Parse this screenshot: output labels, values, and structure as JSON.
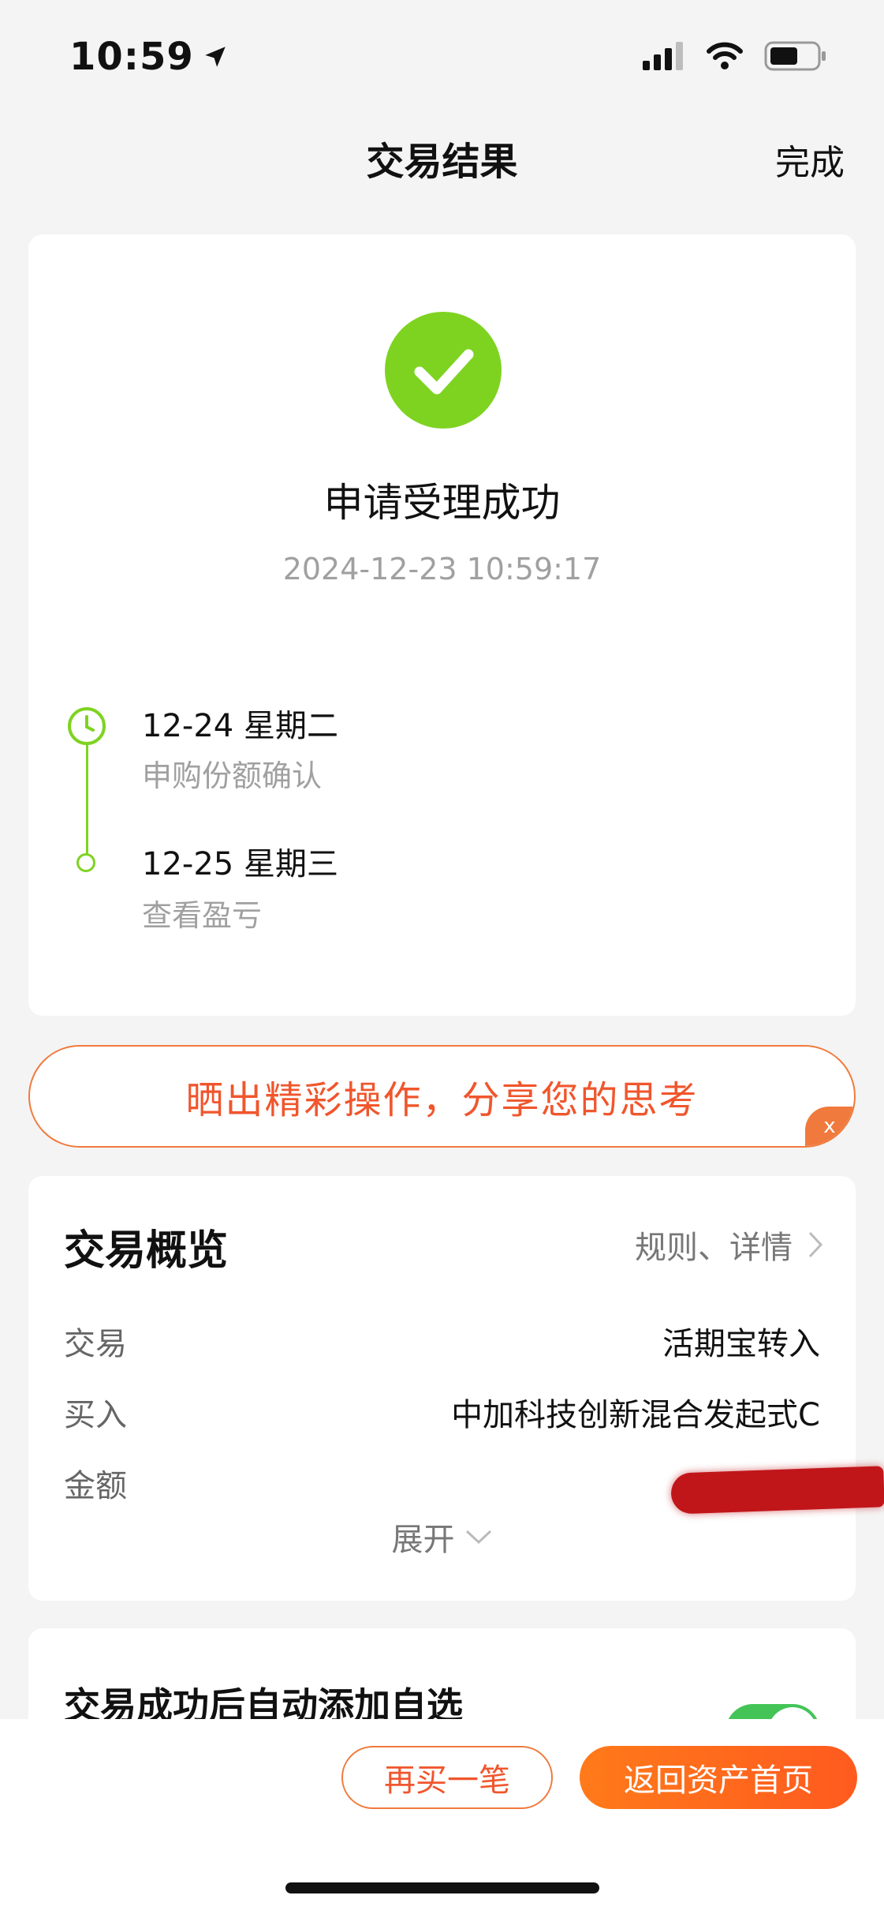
{
  "status_bar": {
    "time": "10:59"
  },
  "nav": {
    "title": "交易结果",
    "done_label": "完成"
  },
  "result": {
    "title": "申请受理成功",
    "timestamp": "2024-12-23 10:59:17",
    "timeline": [
      {
        "date": "12-24  星期二",
        "desc": "申购份额确认"
      },
      {
        "date": "12-25  星期三",
        "desc": "查看盈亏"
      }
    ]
  },
  "share_banner": {
    "text": "晒出精彩操作，分享您的思考",
    "close_label": "x"
  },
  "overview": {
    "title": "交易概览",
    "link_label": "规则、详情",
    "rows": [
      {
        "label": "交易",
        "value": "活期宝转入"
      },
      {
        "label": "买入",
        "value": "中加科技创新混合发起式C"
      },
      {
        "label": "金额",
        "value": ""
      }
    ],
    "expand_label": "展开"
  },
  "auto_watchlist": {
    "label": "交易成功后自动添加自选",
    "enabled": true
  },
  "actions": {
    "buy_again_label": "再买一笔",
    "return_home_label": "返回资产首页"
  },
  "colors": {
    "accent": "#f0562d",
    "success": "#7ed321",
    "toggle_on": "#44c457"
  }
}
